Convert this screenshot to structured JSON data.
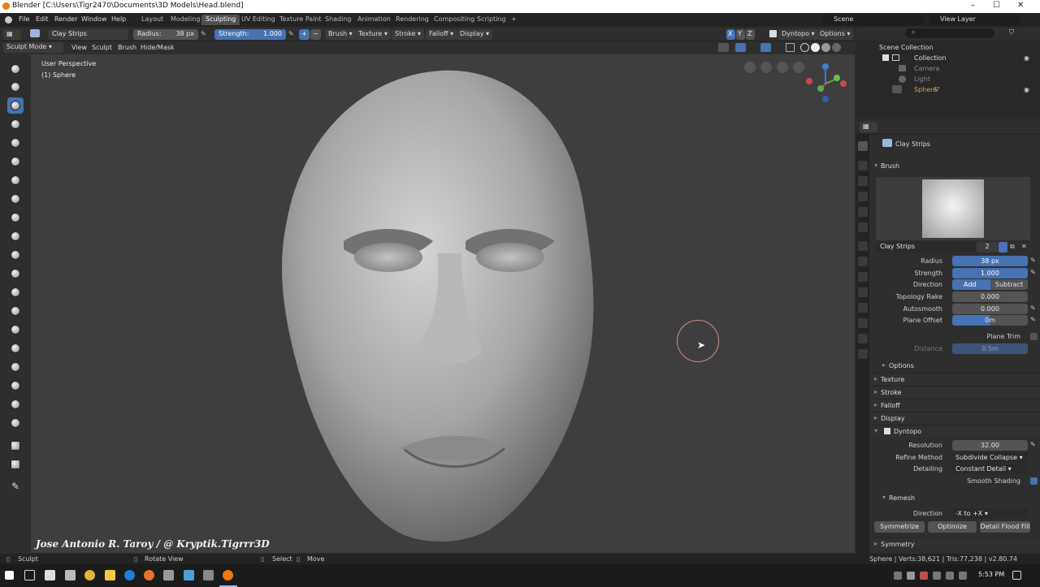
{
  "title_bar": {
    "title": "Blender [C:\\Users\\Tigr2470\\Documents\\3D Models\\Head.blend]",
    "minimize": "–",
    "maximize": "☐",
    "close": "✕"
  },
  "menus": [
    "File",
    "Edit",
    "Render",
    "Window",
    "Help"
  ],
  "workspaces": [
    "Layout",
    "Modeling",
    "Sculpting",
    "UV Editing",
    "Texture Paint",
    "Shading",
    "Animation",
    "Rendering",
    "Compositing",
    "Scripting",
    "+"
  ],
  "active_workspace": "Sculpting",
  "scene": {
    "scene_label": "Scene",
    "view_layer_label": "View Layer"
  },
  "tool_header": {
    "brush_name": "Clay Strips",
    "radius_label": "Radius:",
    "radius_value": "38 px",
    "strength_label": "Strength:",
    "strength_value": "1.000",
    "plus": "+",
    "minus": "−",
    "brush": "Brush",
    "texture": "Texture",
    "stroke": "Stroke",
    "falloff": "Falloff",
    "display": "Display",
    "axis_x": "X",
    "axis_y": "Y",
    "axis_z": "Z",
    "dyntopo": "Dyntopo",
    "options": "Options"
  },
  "mode_header": {
    "mode": "Sculpt Mode",
    "view": "View",
    "sculpt": "Sculpt",
    "brush": "Brush",
    "hide_mask": "Hide/Mask"
  },
  "viewport": {
    "perspective": "User Perspective",
    "object": "(1) Sphere",
    "watermark": "Jose Antonio R. Taroy / @ Kryptik.Tigrrr3D"
  },
  "outliner": {
    "scene_collection": "Scene Collection",
    "items": [
      {
        "label": "Collection"
      },
      {
        "label": "Camera"
      },
      {
        "label": "Light"
      },
      {
        "label": "Sphere"
      }
    ]
  },
  "properties": {
    "active_tool": "Clay Strips",
    "brush_panel": "Brush",
    "brush_name": "Clay Strips",
    "brush_users": "2",
    "fields": [
      {
        "label": "Radius",
        "value": "38 px"
      },
      {
        "label": "Strength",
        "value": "1.000"
      },
      {
        "label": "Topology Rake",
        "value": "0.000"
      },
      {
        "label": "Autosmooth",
        "value": "0.000"
      },
      {
        "label": "Plane Offset",
        "value": "0m"
      }
    ],
    "direction_label": "Direction",
    "direction_add": "Add",
    "direction_subtract": "Subtract",
    "plane_trim": "Plane Trim",
    "distance_label": "Distance",
    "distance_value": "0.5m",
    "options": "Options",
    "panels": [
      "Texture",
      "Stroke",
      "Falloff",
      "Display"
    ],
    "dyntopo": "Dyntopo",
    "resolution_label": "Resolution",
    "resolution_value": "32.00",
    "refine_label": "Refine Method",
    "refine_value": "Subdivide Collapse",
    "detailing_label": "Detailing",
    "detailing_value": "Constant Detail",
    "smooth_shading": "Smooth Shading",
    "remesh": "Remesh",
    "remesh_direction_label": "Direction",
    "remesh_direction_value": "-X to +X",
    "symmetrize": "Symmetrize",
    "optimize": "Optimize",
    "detail_flood_fill": "Detail Flood Fill",
    "symmetry": "Symmetry"
  },
  "status_bar": {
    "sculpt": "Sculpt",
    "rotate": "Rotate View",
    "select": "Select",
    "move": "Move",
    "stats": "Sphere | Verts:38,621 | Tris:77,238 | v2.80.74"
  },
  "taskbar": {
    "time": "5:53 PM"
  },
  "colors": {
    "accent": "#4772b3",
    "background": "#3e3e3e",
    "panel": "#2e2e2e"
  }
}
